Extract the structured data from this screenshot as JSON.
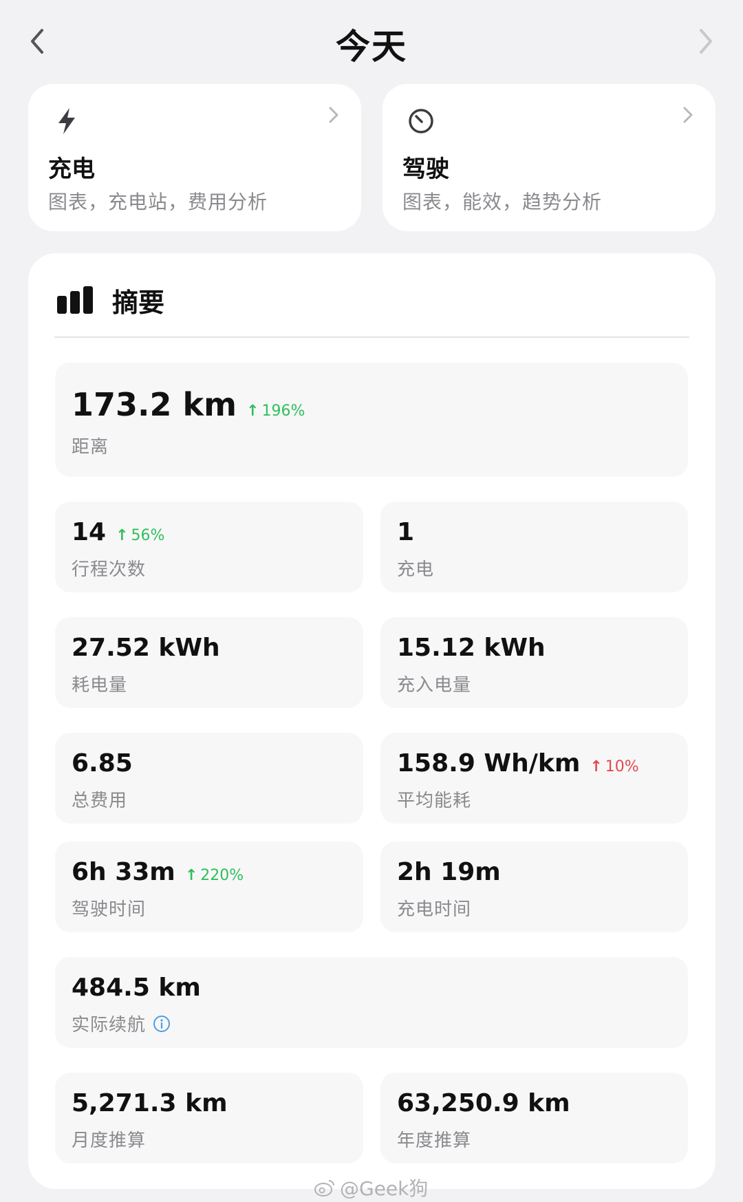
{
  "header": {
    "title": "今天"
  },
  "nav_cards": [
    {
      "title": "充电",
      "subtitle": "图表，充电站，费用分析",
      "icon": "lightning-icon"
    },
    {
      "title": "驾驶",
      "subtitle": "图表，能效，趋势分析",
      "icon": "speedometer-icon"
    }
  ],
  "summary": {
    "title": "摘要",
    "icon": "bar-chart-icon",
    "distance": {
      "value": "173.2 km",
      "delta": "196%",
      "delta_direction": "up",
      "delta_color": "#2fbf5b",
      "label": "距离"
    },
    "trips": {
      "value": "14",
      "delta": "56%",
      "delta_direction": "up",
      "delta_color": "#2fbf5b",
      "label": "行程次数"
    },
    "charges": {
      "value": "1",
      "label": "充电"
    },
    "energy_used": {
      "value": "27.52 kWh",
      "label": "耗电量"
    },
    "energy_charged": {
      "value": "15.12 kWh",
      "label": "充入电量"
    },
    "total_cost": {
      "value": "6.85",
      "label": "总费用"
    },
    "avg_consumption": {
      "value": "158.9 Wh/km",
      "delta": "10%",
      "delta_direction": "up",
      "delta_color": "#e5484d",
      "label": "平均能耗"
    },
    "drive_time": {
      "value": "6h 33m",
      "delta": "220%",
      "delta_direction": "up",
      "delta_color": "#2fbf5b",
      "label": "驾驶时间"
    },
    "charge_time": {
      "value": "2h 19m",
      "label": "充电时间"
    },
    "real_range": {
      "value": "484.5 km",
      "label": "实际续航",
      "icon": "info-icon"
    },
    "monthly_estimate": {
      "value": "5,271.3 km",
      "label": "月度推算"
    },
    "yearly_estimate": {
      "value": "63,250.9 km",
      "label": "年度推算"
    }
  },
  "watermark": {
    "text": "@Geek狗",
    "icon": "weibo-icon"
  },
  "colors": {
    "background": "#f2f2f4",
    "card": "#ffffff",
    "stat_bg": "#f7f7f8",
    "positive": "#2fbf5b",
    "negative": "#e5484d",
    "muted_text": "#8a8a8e"
  }
}
